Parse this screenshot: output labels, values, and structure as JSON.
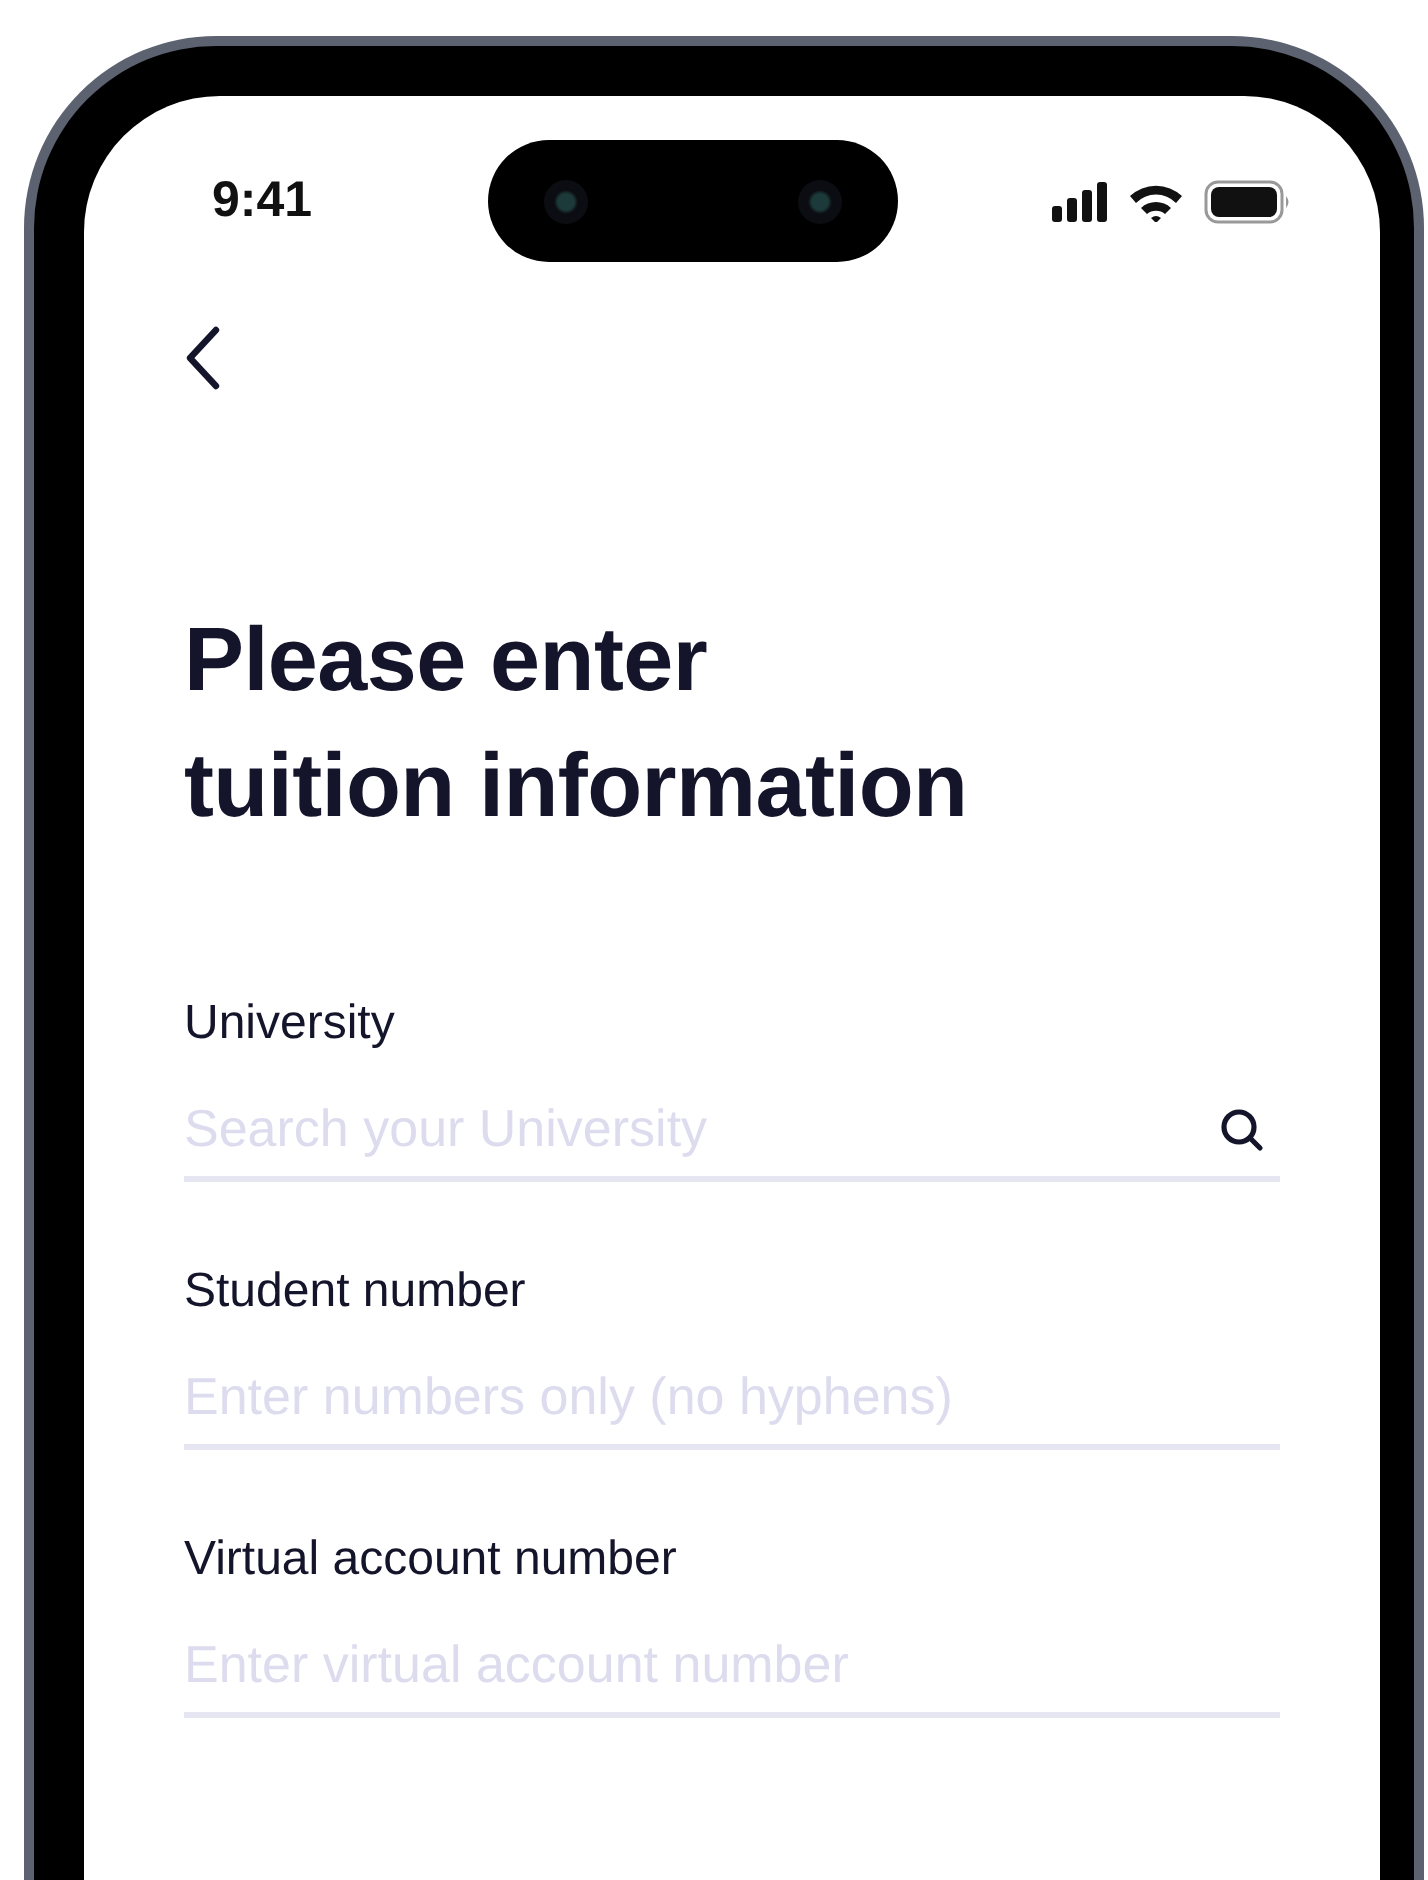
{
  "status_bar": {
    "time": "9:41"
  },
  "title_lines": [
    "Please enter",
    "tuition information"
  ],
  "fields": [
    {
      "kind": "search",
      "label": "University",
      "placeholder": "Search your University"
    },
    {
      "kind": "text",
      "label": "Student number",
      "placeholder": "Enter numbers only (no hyphens)"
    },
    {
      "kind": "text",
      "label": "Virtual account number",
      "placeholder": "Enter virtual account number"
    }
  ]
}
